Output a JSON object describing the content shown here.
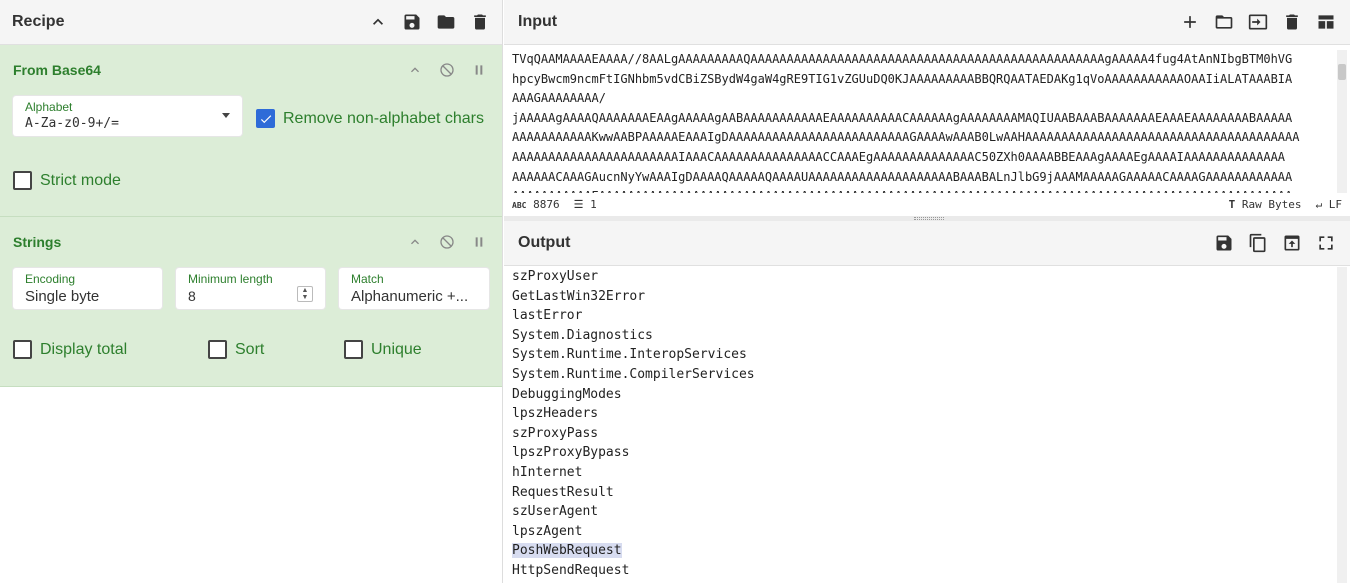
{
  "recipe": {
    "title": "Recipe",
    "operations": [
      {
        "name": "From Base64",
        "alphabet_label": "Alphabet",
        "alphabet_value": "A-Za-z0-9+/=",
        "remove_label": "Remove non-alphabet chars",
        "remove_checked": true,
        "strict_label": "Strict mode",
        "strict_checked": false
      },
      {
        "name": "Strings",
        "encoding_label": "Encoding",
        "encoding_value": "Single byte",
        "minlen_label": "Minimum length",
        "minlen_value": "8",
        "match_label": "Match",
        "match_value": "Alphanumeric +...",
        "display_total_label": "Display total",
        "sort_label": "Sort",
        "unique_label": "Unique"
      }
    ]
  },
  "input": {
    "title": "Input",
    "lines": [
      "TVqQAAMAAAAEAAAA//8AALgAAAAAAAAAQAAAAAAAAAAAAAAAAAAAAAAAAAAAAAAAAAAAAAAAAAAAAAAAAAgAAAAA4fug4AtAnNIbgBTM0hVG",
      "hpcyBwcm9ncmFtIGNhbm5vdCBiZSBydW4gaW4gRE9TIG1vZGUuDQ0KJAAAAAAAAABBQRQAATAEDAKg1qVoAAAAAAAAAAAOAAIiALATAAABIA",
      "AAAGAAAAAAAA/",
      "jAAAAAgAAAAQAAAAAAAEAAgAAAAAgAABAAAAAAAAAAAEAAAAAAAAAACAAAAAAgAAAAAAAAMAQIUAABAAABAAAAAAAEAAAEAAAAAAAABAAAAA",
      "AAAAAAAAAAAKwwAABPAAAAAEAAAIgDAAAAAAAAAAAAAAAAAAAAAAAAAGAAAAwAAAB0LwAAHAAAAAAAAAAAAAAAAAAAAAAAAAAAAAAAAAAAAAA",
      "AAAAAAAAAAAAAAAAAAAAAAAIAAACAAAAAAAAAAAAAAACCAAAEgAAAAAAAAAAAAAAC50ZXh0AAAABBEAAAgAAAAEgAAAAIAAAAAAAAAAAAAA",
      "AAAAAACAAAGAucnNyYwAAAIgDAAAAQAAAAAQAAAAUAAAAAAAAAAAAAAAAAAAABAAABALnJlbG9jAAAMAAAAAGAAAAACAAAAGAAAAAAAAAAAA",
      "AAAAAAAAAAAEAAAAAAAAAAAAAAAAAAAAAAAAAAAAAAAAAAAAAAAAAAAAAAAAAAAAAAAAAAAAAAAAAAAAAAAAAAAAAAAAAAAAAAAAAAAAAAAA"
    ],
    "char_count": "8876",
    "line_count": "1",
    "raw_bytes_label": "Raw Bytes",
    "eol_label": "LF"
  },
  "output": {
    "title": "Output",
    "lines": [
      "szProxyUser",
      "GetLastWin32Error",
      "lastError",
      "System.Diagnostics",
      "System.Runtime.InteropServices",
      "System.Runtime.CompilerServices",
      "DebuggingModes",
      "lpszHeaders",
      "szProxyPass",
      "lpszProxyBypass",
      "hInternet",
      "RequestResult",
      "szUserAgent",
      "lpszAgent",
      "PoshWebRequest",
      "HttpSendRequest"
    ],
    "highlighted_line": "PoshWebRequest"
  },
  "colors": {
    "op_bg": "#dcedd7",
    "op_text": "#2d7f2d",
    "checkbox_blue": "#2e6bd8"
  }
}
